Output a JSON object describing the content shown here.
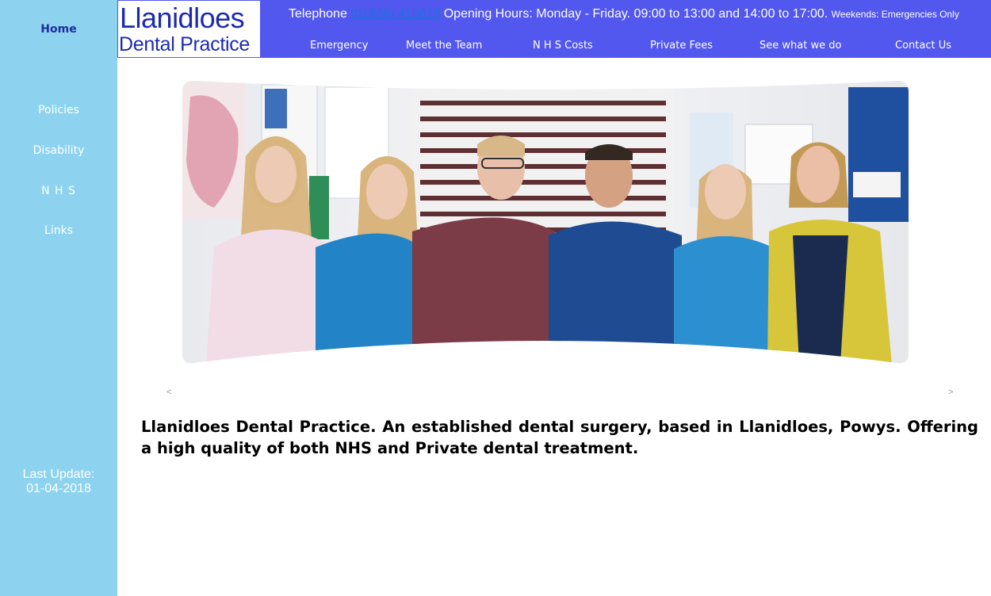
{
  "sidebar": {
    "items": [
      {
        "label": "Home"
      },
      {
        "label": "Policies"
      },
      {
        "label": "Disability"
      },
      {
        "label": "N H S"
      },
      {
        "label": "Links"
      }
    ],
    "last_update_label": "Last Update:",
    "last_update_date": "01-04-2018"
  },
  "logo": {
    "line1": "Llanidloes",
    "line2": "Dental Practice"
  },
  "header": {
    "telephone_label": "Telephone",
    "telephone_number": "(01686) 413679",
    "opening_hours": "Opening Hours: Monday - Friday. 09:00 to 13:00 and 14:00 to 17:00.",
    "weekends": "Weekends:  Emergencies Only"
  },
  "nav": {
    "items": [
      {
        "label": "Emergency"
      },
      {
        "label": "Meet the Team"
      },
      {
        "label": "N H S Costs"
      },
      {
        "label": "Private Fees"
      },
      {
        "label": "See what we do"
      },
      {
        "label": "Contact Us"
      }
    ]
  },
  "carousel": {
    "prev": "<",
    "next": ">"
  },
  "intro": "Llanidloes Dental Practice.  An established dental surgery, based in Llanidloes, Powys.  Offering a high quality of both NHS and Private dental treatment.",
  "colors": {
    "sidebar": "#8dd3f0",
    "topbar": "#5257ee",
    "logo_text": "#1d2ab0",
    "home_link": "#1f2f9a"
  }
}
